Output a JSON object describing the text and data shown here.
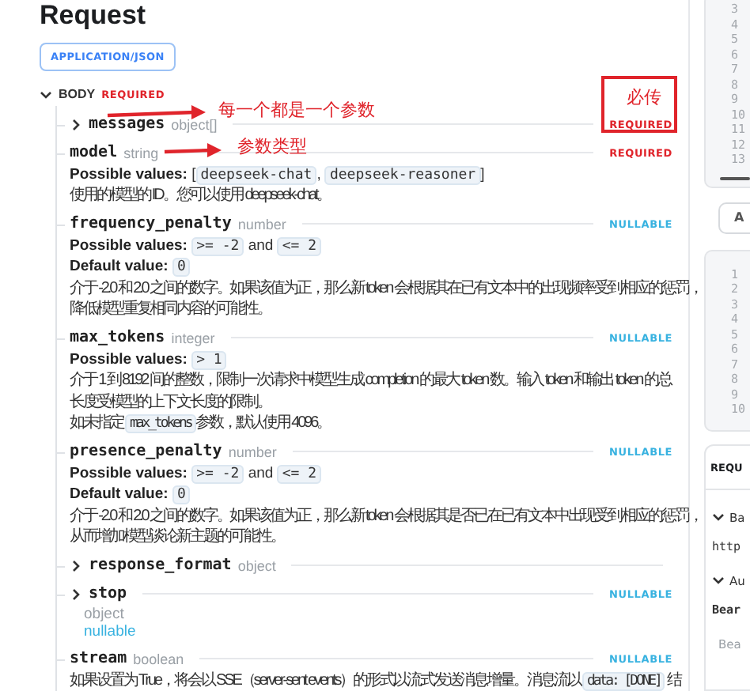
{
  "title": "Request",
  "content_type": "APPLICATION/JSON",
  "body": {
    "label": "BODY",
    "badge": {
      "text": "REQUIRED",
      "kind": "required"
    },
    "expanded": true
  },
  "fields": [
    {
      "name": "messages",
      "type": "object[]",
      "expandable": true,
      "expanded": false,
      "badge": {
        "text": "REQUIRED",
        "kind": "required"
      }
    },
    {
      "name": "model",
      "type": "string",
      "badge": {
        "text": "REQUIRED",
        "kind": "required"
      },
      "values": [
        {
          "label": "Possible values:",
          "parts": [
            {
              "kind": "text",
              "text": "["
            },
            {
              "kind": "code",
              "text": "deepseek-chat"
            },
            {
              "kind": "text",
              "text": ", "
            },
            {
              "kind": "code",
              "text": "deepseek-reasoner"
            },
            {
              "kind": "text",
              "text": "]"
            }
          ]
        }
      ],
      "description": [
        [
          {
            "kind": "text",
            "text": "使用的模型的 ID。您可以使用 deepseek-chat。"
          }
        ]
      ]
    },
    {
      "name": "frequency_penalty",
      "type": "number",
      "badge": {
        "text": "NULLABLE",
        "kind": "nullable"
      },
      "values": [
        {
          "label": "Possible values:",
          "parts": [
            {
              "kind": "code",
              "text": ">= -2"
            },
            {
              "kind": "text",
              "text": " and "
            },
            {
              "kind": "code",
              "text": "<= 2"
            }
          ]
        },
        {
          "label": "Default value:",
          "parts": [
            {
              "kind": "code",
              "text": "0"
            }
          ]
        }
      ],
      "description": [
        [
          {
            "kind": "text",
            "text": "介于 -2.0 和 2.0 之间的数字。如果该值为正，那么新 token 会根据其在已有文本中的出现频率受到相应的惩罚，"
          }
        ],
        [
          {
            "kind": "text",
            "text": "降低模型重复相同内容的可能性。"
          }
        ]
      ]
    },
    {
      "name": "max_tokens",
      "type": "integer",
      "badge": {
        "text": "NULLABLE",
        "kind": "nullable"
      },
      "values": [
        {
          "label": "Possible values:",
          "parts": [
            {
              "kind": "code",
              "text": "> 1"
            }
          ]
        }
      ],
      "description": [
        [
          {
            "kind": "text",
            "text": "介于 1 到 8192 间的整数，限制一次请求中模型生成 completion 的最大 token 数。输入 token 和输出 token 的总"
          }
        ],
        [
          {
            "kind": "text",
            "text": "长度受模型的上下文长度的限制。"
          }
        ],
        [
          {
            "kind": "text",
            "text": "如未指定 "
          },
          {
            "kind": "code",
            "text": "max_tokens"
          },
          {
            "kind": "text",
            "text": "参数，默认使用 4096。"
          }
        ]
      ]
    },
    {
      "name": "presence_penalty",
      "type": "number",
      "badge": {
        "text": "NULLABLE",
        "kind": "nullable"
      },
      "values": [
        {
          "label": "Possible values:",
          "parts": [
            {
              "kind": "code",
              "text": ">= -2"
            },
            {
              "kind": "text",
              "text": " and "
            },
            {
              "kind": "code",
              "text": "<= 2"
            }
          ]
        },
        {
          "label": "Default value:",
          "parts": [
            {
              "kind": "code",
              "text": "0"
            }
          ]
        }
      ],
      "description": [
        [
          {
            "kind": "text",
            "text": "介于 -2.0 和 2.0 之间的数字。如果该值为正，那么新 token 会根据其是否已在已有文本中出现受到相应的惩罚，"
          }
        ],
        [
          {
            "kind": "text",
            "text": "从而增加模型谈论新主题的可能性。"
          }
        ]
      ]
    },
    {
      "name": "response_format",
      "type": "object",
      "expandable": true,
      "expanded": false
    },
    {
      "name": "stop",
      "expandable": true,
      "expanded": false,
      "badge": {
        "text": "NULLABLE",
        "kind": "nullable"
      },
      "details": [
        {
          "kind": "type",
          "text": "object"
        },
        {
          "kind": "nullable",
          "text": "nullable"
        }
      ]
    },
    {
      "name": "stream",
      "type": "boolean",
      "badge": {
        "text": "NULLABLE",
        "kind": "nullable"
      },
      "description": [
        [
          {
            "kind": "text",
            "text": "如果设置为 True，将会以 SSE（server-sent events）的形式以流式发送消息增量。消息流以 "
          },
          {
            "kind": "code",
            "text": "data: [DONE]"
          },
          {
            "kind": "text",
            "text": " 结"
          }
        ]
      ]
    }
  ],
  "annotations": [
    {
      "kind": "arrow",
      "text": "每一个都是一个参数"
    },
    {
      "kind": "arrow",
      "text": "参数类型"
    },
    {
      "kind": "box",
      "text": "必传"
    }
  ],
  "side_panel": {
    "code_block_top": {
      "line_numbers": [
        "3",
        "4",
        "5",
        "6",
        "7",
        "8",
        "9",
        "10",
        "11",
        "12",
        "13"
      ]
    },
    "button": "A",
    "code_block_bottom": {
      "line_numbers": [
        "1",
        "2",
        "3",
        "4",
        "5",
        "6",
        "7",
        "8",
        "9",
        "10"
      ]
    },
    "auth_card": {
      "title": "REQU",
      "rows": [
        {
          "kind": "section",
          "text": "Ba"
        },
        {
          "kind": "code",
          "text": "http"
        },
        {
          "kind": "section",
          "text": "Au"
        },
        {
          "kind": "label",
          "text": "Bear"
        },
        {
          "kind": "hint",
          "text": "Bea"
        }
      ]
    }
  }
}
